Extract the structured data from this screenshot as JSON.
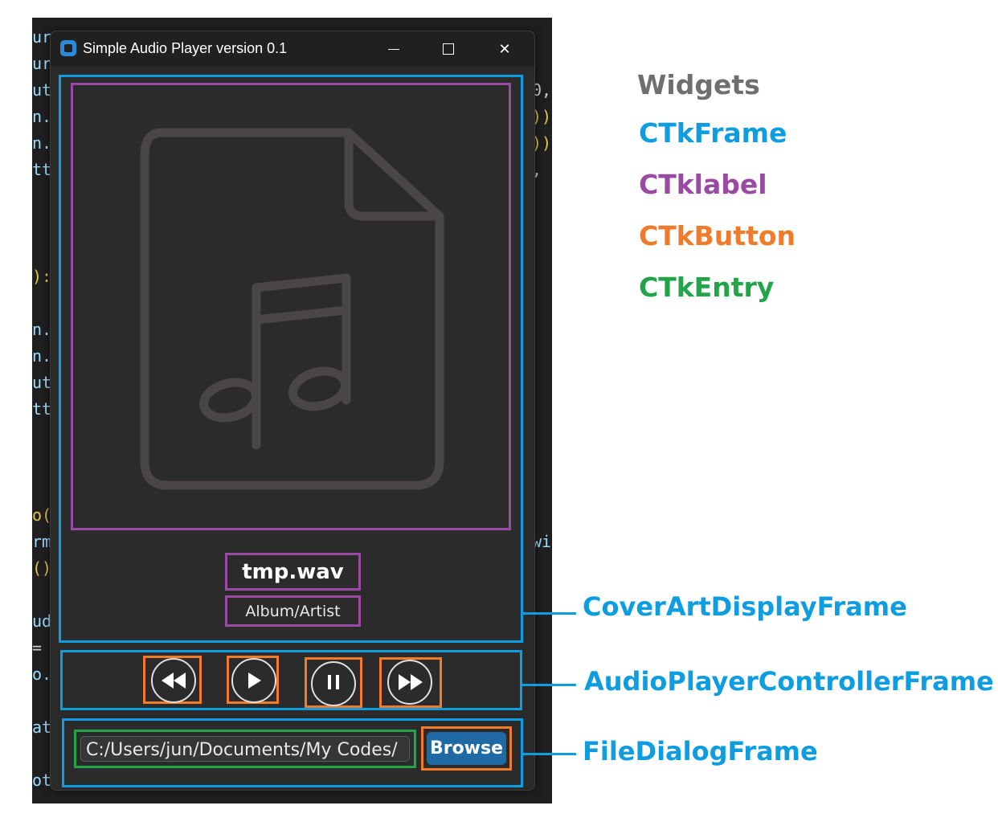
{
  "window": {
    "title": "Simple Audio Player version 0.1",
    "minimize_symbol": "",
    "maximize_symbol": "",
    "close_symbol": "✕"
  },
  "cover": {
    "icon": "music-file-icon",
    "song_title": "tmp.wav",
    "album_artist": "Album/Artist"
  },
  "controls": {
    "rewind_icon": "rewind-icon",
    "play_icon": "play-icon",
    "pause_icon": "pause-icon",
    "fast_forward_icon": "fast-forward-icon"
  },
  "file_dialog": {
    "path_value": "C:/Users/jun/Documents/My Codes/",
    "browse_label": "Browse"
  },
  "legend": {
    "heading": "Widgets",
    "items": [
      {
        "label": "CTkFrame",
        "color": "#0e9de0"
      },
      {
        "label": "CTklabel",
        "color": "#9b4aa3"
      },
      {
        "label": "CTkButton",
        "color": "#f07b2a"
      },
      {
        "label": "CTkEntry",
        "color": "#21a548"
      }
    ]
  },
  "callouts": {
    "cover_frame": "CoverArtDisplayFrame",
    "controller_frame": "AudioPlayerControllerFrame",
    "file_dialog_frame": "FileDialogFrame"
  },
  "code_fragments": [
    "ur",
    "ur",
    "ut",
    "n.",
    "n.",
    "tt",
    "):",
    "n.",
    "n.",
    "ut",
    "tt",
    "o(",
    "rm",
    "()",
    "ud",
    "=",
    "o.",
    "at",
    "ot"
  ],
  "code_fragments_right": [
    "0,",
    "))",
    "))",
    ",",
    "wi"
  ],
  "colors": {
    "frame": "#0e9de0",
    "label": "#9b4aa3",
    "button": "#f07b2a",
    "entry": "#21a548",
    "browse_bg": "#1f6aa5"
  }
}
